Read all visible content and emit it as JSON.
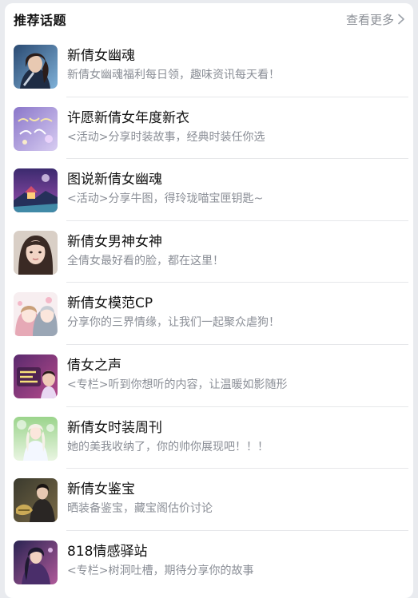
{
  "header": {
    "title": "推荐话题",
    "more_label": "查看更多"
  },
  "colors": {
    "title": "#111111",
    "subtitle": "#8a8e96",
    "divider": "#e6e7ea",
    "page_bg": "#e9ebef"
  },
  "topics": [
    {
      "title": "新倩女幽魂",
      "desc": "新倩女幽魂福利每日领，趣味资讯每天看！",
      "thumb": "warrior-portrait-image"
    },
    {
      "title": "许愿新倩女年度新衣",
      "desc": "<活动>分享时装故事，经典时装任你选",
      "thumb": "wish-new-outfit-banner-image"
    },
    {
      "title": "图说新倩女幽魂",
      "desc": "<活动>分享牛图，得玲珑喵宝匣钥匙~",
      "thumb": "night-pavilion-scene-image"
    },
    {
      "title": "新倩女男神女神",
      "desc": "全倩女最好看的脸，都在这里！",
      "thumb": "girl-portrait-image"
    },
    {
      "title": "新倩女模范CP",
      "desc": "分享你的三界情缘，让我们一起聚众虐狗！",
      "thumb": "anime-couple-image"
    },
    {
      "title": "倩女之声",
      "desc": "<专栏>听到你想听的内容，让温暖如影随形",
      "thumb": "radio-show-banner-image"
    },
    {
      "title": "新倩女时装周刊",
      "desc": "她的美我收纳了，你的帅你展现吧！！！",
      "thumb": "fashion-character-image"
    },
    {
      "title": "新倩女鉴宝",
      "desc": "晒装备鉴宝，藏宝阁估价讨论",
      "thumb": "treasure-appraisal-image"
    },
    {
      "title": "818情感驿站",
      "desc": "<专栏>树洞吐槽，期待分享你的故事",
      "thumb": "emotion-station-character-image"
    }
  ]
}
